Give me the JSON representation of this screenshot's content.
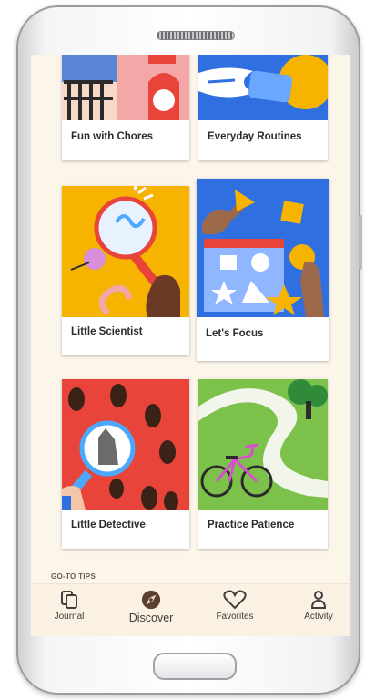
{
  "cards": [
    {
      "label": "Fun with Chores"
    },
    {
      "label": "Everyday Routines"
    },
    {
      "label": "Little Scientist"
    },
    {
      "label": "Let's Focus"
    },
    {
      "label": "Little Detective"
    },
    {
      "label": "Practice Patience"
    }
  ],
  "section_label": "GO-TO TIPS",
  "tabs": [
    {
      "label": "Journal",
      "icon": "journal-icon"
    },
    {
      "label": "Discover",
      "icon": "compass-icon",
      "active": true
    },
    {
      "label": "Favorites",
      "icon": "heart-icon"
    },
    {
      "label": "Activity",
      "icon": "person-icon"
    }
  ],
  "colors": {
    "screen_bg": "#fbf5ea",
    "tabbar_bg": "#faf1e2",
    "yellow": "#f6b400",
    "blue": "#2f6fe0",
    "red": "#e8443a",
    "green": "#7cc24a"
  }
}
